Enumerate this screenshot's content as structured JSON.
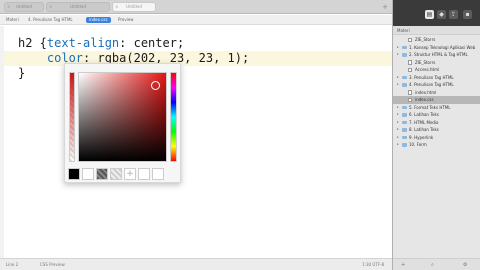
{
  "tabs": [
    {
      "label": "Untitled"
    },
    {
      "label": "Untitled"
    },
    {
      "label": "Untitled"
    }
  ],
  "tab_add": "+",
  "breadcrumb": [
    "Materi",
    "4. Penulisan Tag HTML",
    "index.css",
    "Preview"
  ],
  "editor": {
    "line1_prefix": "h2 {",
    "line1_prop": "text-align",
    "line1_rest": ": center;",
    "line2_indent": "    ",
    "line2_prop": "color",
    "line2_rest": ": rgba(202, 23, 23, 1);",
    "line3": "}"
  },
  "color_picker": {
    "value": "rgba(202, 23, 23, 1)",
    "add_swatch": "+"
  },
  "statusbar": {
    "left1": "Line 2",
    "left2": "CSS Preview",
    "right": "1:30  UTF-8"
  },
  "sidebar": {
    "header": "Materi",
    "items": [
      {
        "label": "ZIE_Storrs",
        "type": "file",
        "depth": 1,
        "selected": false
      },
      {
        "label": "1. Konsep Teknologi Aplikasi Web",
        "type": "folder",
        "depth": 0,
        "selected": false
      },
      {
        "label": "2. Struktur HTML & Tag HTML",
        "type": "folder",
        "depth": 0,
        "selected": false
      },
      {
        "label": "ZIE_Storrs",
        "type": "file",
        "depth": 1,
        "selected": false
      },
      {
        "label": "Access.html",
        "type": "file",
        "depth": 1,
        "selected": false
      },
      {
        "label": "3. Penulisan Tag HTML",
        "type": "folder",
        "depth": 0,
        "selected": false
      },
      {
        "label": "4. Penulisan Tag HTML",
        "type": "folder",
        "depth": 0,
        "selected": false
      },
      {
        "label": "index.html",
        "type": "file",
        "depth": 1,
        "selected": false
      },
      {
        "label": "index.css",
        "type": "file",
        "depth": 1,
        "selected": true
      },
      {
        "label": "5. Format Teks HTML",
        "type": "folder",
        "depth": 0,
        "selected": false
      },
      {
        "label": "6. Latihan Teks",
        "type": "folder",
        "depth": 0,
        "selected": false
      },
      {
        "label": "7. HTML Media",
        "type": "folder",
        "depth": 0,
        "selected": false
      },
      {
        "label": "8. Latihan Teks",
        "type": "folder",
        "depth": 0,
        "selected": false
      },
      {
        "label": "9. Hyperlink",
        "type": "folder",
        "depth": 0,
        "selected": false
      },
      {
        "label": "10. Form",
        "type": "folder",
        "depth": 0,
        "selected": false
      }
    ],
    "bottom_icons": [
      "+",
      "⌕",
      "⚙"
    ]
  },
  "colors": {
    "accent": "#3b82e0",
    "picked": "#ca1717"
  }
}
